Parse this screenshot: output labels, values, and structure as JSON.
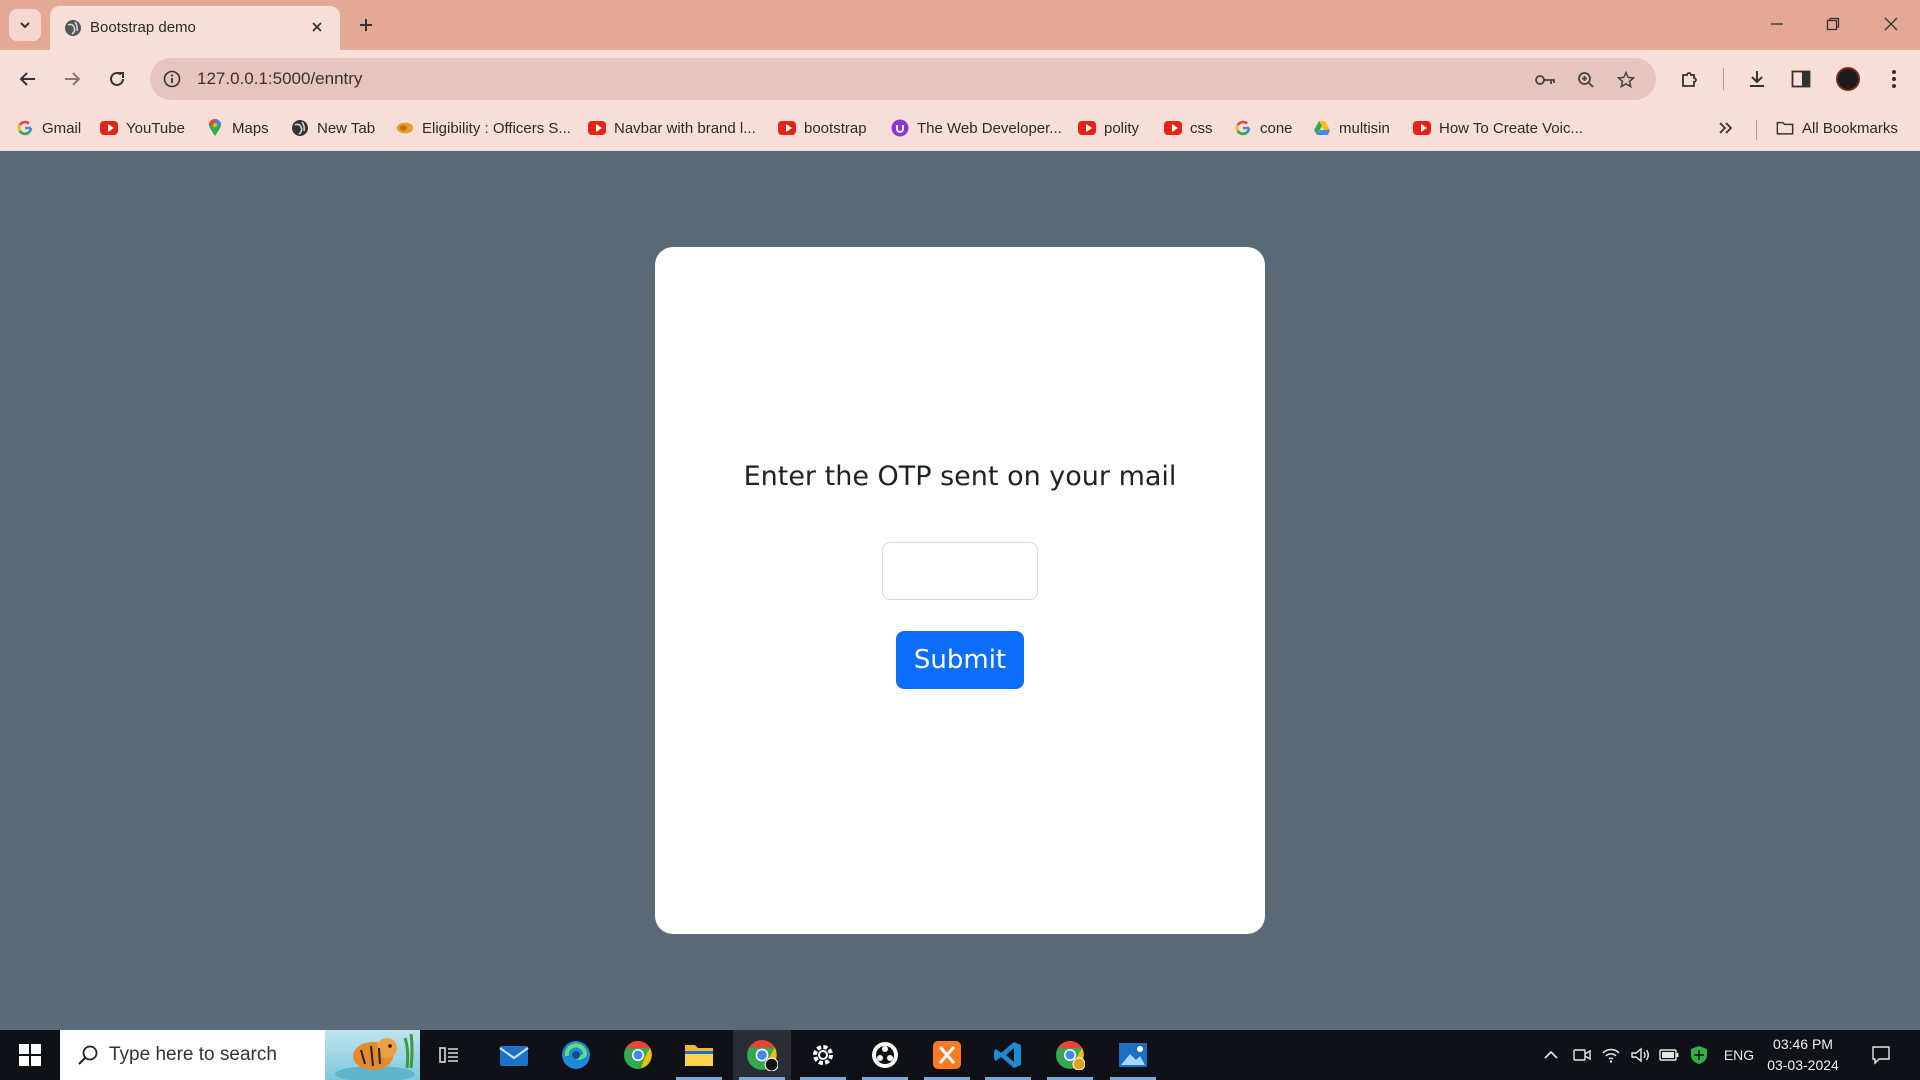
{
  "browser": {
    "tab": {
      "title": "Bootstrap demo"
    },
    "address_bar": {
      "url": "127.0.0.1:5000/enntry"
    },
    "bookmarks": [
      {
        "label": "Gmail",
        "icon": "google-icon"
      },
      {
        "label": "YouTube",
        "icon": "youtube-icon"
      },
      {
        "label": "Maps",
        "icon": "maps-icon"
      },
      {
        "label": "New Tab",
        "icon": "globe-icon"
      },
      {
        "label": "Eligibility : Officers S...",
        "icon": "emblem-icon"
      },
      {
        "label": "Navbar with brand l...",
        "icon": "youtube-icon"
      },
      {
        "label": "bootstrap",
        "icon": "youtube-icon"
      },
      {
        "label": "The Web Developer...",
        "icon": "udemy-icon"
      },
      {
        "label": "polity",
        "icon": "youtube-icon"
      },
      {
        "label": "css",
        "icon": "youtube-icon"
      },
      {
        "label": "cone",
        "icon": "google-icon"
      },
      {
        "label": "multisin",
        "icon": "drive-icon"
      },
      {
        "label": "How To Create Voic...",
        "icon": "youtube-icon"
      }
    ],
    "all_bookmarks_label": "All Bookmarks"
  },
  "page": {
    "prompt": "Enter the OTP sent on your mail",
    "otp_value": "",
    "submit_label": "Submit",
    "colors": {
      "background": "#5b6a79",
      "card": "#ffffff",
      "button": "#0d6efd"
    }
  },
  "taskbar": {
    "search_placeholder": "Type here to search",
    "language": "ENG",
    "time": "03:46 PM",
    "date": "03-03-2024"
  }
}
